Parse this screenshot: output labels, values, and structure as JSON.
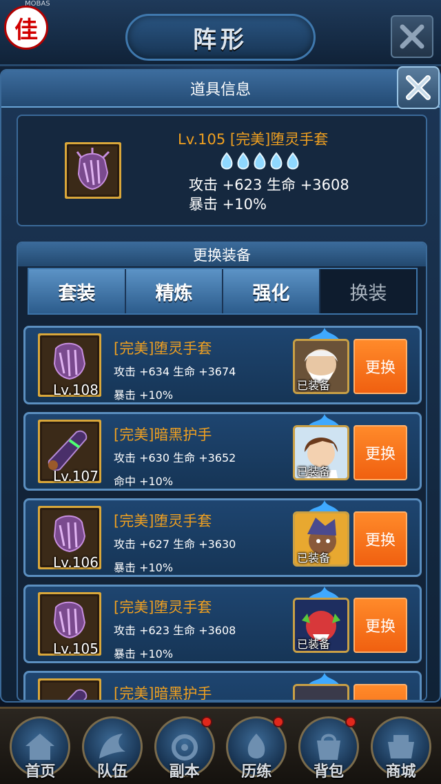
{
  "app": {
    "logo_char": "佳",
    "logo_tag": "MOBAS",
    "page_title": "阵形"
  },
  "dialog": {
    "title": "道具信息",
    "item": {
      "name": "Lv.105 [完美]堕灵手套",
      "stars": 5,
      "stats_line1": "攻击 +623  生命 +3608",
      "stats_line2": "暴击 +10%"
    },
    "change_panel": {
      "title": "更换装备",
      "tabs": [
        {
          "label": "套装"
        },
        {
          "label": "精炼"
        },
        {
          "label": "强化"
        },
        {
          "label": "换装",
          "active": true
        }
      ],
      "rows": [
        {
          "level": "Lv.108",
          "name": "[完美]堕灵手套",
          "stats": "攻击 +634   生命 +3674",
          "extra": "暴击 +10%",
          "hero": "old-sage",
          "equipped_label": "已装备",
          "button": "更换"
        },
        {
          "level": "Lv.107",
          "name": "[完美]暗黑护手",
          "stats": "攻击 +630   生命 +3652",
          "extra": "命中 +10%",
          "hero": "brown-hair-swordsman",
          "equipped_label": "已装备",
          "button": "更换"
        },
        {
          "level": "Lv.106",
          "name": "[完美]堕灵手套",
          "stats": "攻击 +627   生命 +3630",
          "extra": "暴击 +10%",
          "hero": "dark-warrior",
          "equipped_label": "已装备",
          "button": "更换"
        },
        {
          "level": "Lv.105",
          "name": "[完美]堕灵手套",
          "stats": "攻击 +623   生命 +3608",
          "extra": "暴击 +10%",
          "hero": "red-demon",
          "equipped_label": "已装备",
          "button": "更换"
        },
        {
          "level": "",
          "name": "[完美]暗黑护手",
          "stats": "",
          "extra": "",
          "hero": "armored-hero",
          "equipped_label": "",
          "button": ""
        }
      ]
    }
  },
  "nav": [
    {
      "label": "首页",
      "icon": "home-icon",
      "badge": false
    },
    {
      "label": "队伍",
      "icon": "team-icon",
      "badge": false
    },
    {
      "label": "副本",
      "icon": "dungeon-icon",
      "badge": true
    },
    {
      "label": "历练",
      "icon": "training-icon",
      "badge": true
    },
    {
      "label": "背包",
      "icon": "bag-icon",
      "badge": true
    },
    {
      "label": "商城",
      "icon": "shop-icon",
      "badge": false
    }
  ],
  "colors": {
    "gold_text": "#f0a020",
    "swap_button": "#f06010",
    "panel_blue": "#1e4570"
  }
}
